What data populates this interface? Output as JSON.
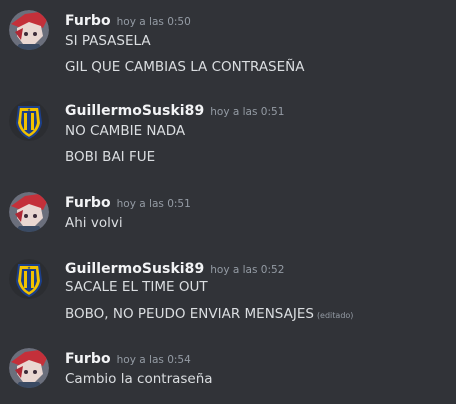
{
  "messages": [
    {
      "username": "Furbo",
      "timestamp": "hoy a las 0:50",
      "avatar_icon": "furbo-avatar-icon",
      "lines": [
        "SI PASASELA",
        "GIL QUE CAMBIAS LA CONTRASEÑA"
      ]
    },
    {
      "username": "GuillermoSuski89",
      "timestamp": "hoy a las 0:51",
      "avatar_icon": "rosario-central-crest-icon",
      "lines": [
        "NO CAMBIE NADA",
        "BOBI BAI FUE"
      ]
    },
    {
      "username": "Furbo",
      "timestamp": "hoy a las 0:51",
      "avatar_icon": "furbo-avatar-icon",
      "lines": [
        "Ahi volvi"
      ]
    },
    {
      "username": "GuillermoSuski89",
      "timestamp": "hoy a las 0:52",
      "avatar_icon": "rosario-central-crest-icon",
      "lines": [
        "SACALE EL TIME OUT",
        "BOBO, NO PEUDO ENVIAR MENSAJES"
      ],
      "edited_label": "(editado)"
    },
    {
      "username": "Furbo",
      "timestamp": "hoy a las 0:54",
      "avatar_icon": "furbo-avatar-icon",
      "lines": [
        "Cambio la contraseña"
      ]
    }
  ],
  "colors": {
    "background": "#313338",
    "username": "#f2f3f5",
    "text": "#dbdee1",
    "timestamp": "#949ba4"
  }
}
